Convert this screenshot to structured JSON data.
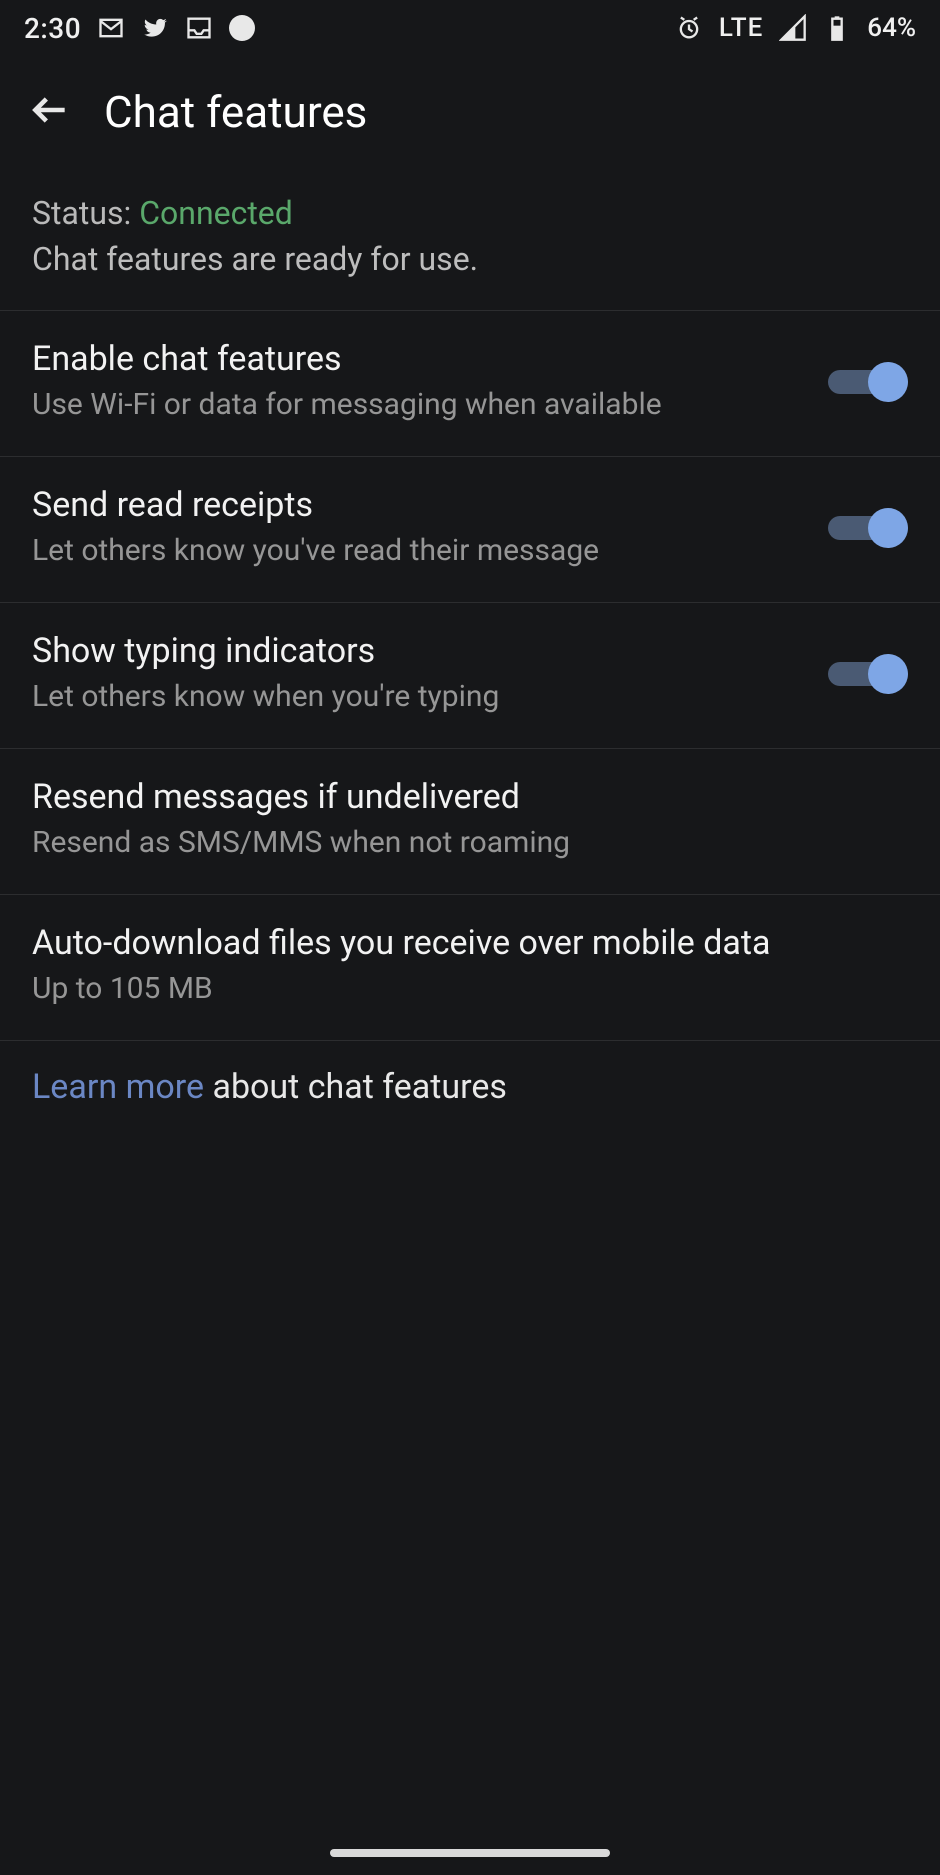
{
  "statusbar": {
    "time": "2:30",
    "network": "LTE",
    "battery": "64%"
  },
  "header": {
    "title": "Chat features"
  },
  "status": {
    "label": "Status: ",
    "value": "Connected",
    "subtitle": "Chat features are ready for use."
  },
  "settings": [
    {
      "title": "Enable chat features",
      "subtitle": "Use Wi-Fi or data for messaging when available",
      "toggle": true
    },
    {
      "title": "Send read receipts",
      "subtitle": "Let others know you've read their message",
      "toggle": true
    },
    {
      "title": "Show typing indicators",
      "subtitle": "Let others know when you're typing",
      "toggle": true
    },
    {
      "title": "Resend messages if undelivered",
      "subtitle": "Resend as SMS/MMS when not roaming",
      "toggle": null
    },
    {
      "title": "Auto-download files you receive over mobile data",
      "subtitle": "Up to 105 MB",
      "toggle": null
    }
  ],
  "learn": {
    "link": "Learn more",
    "rest": " about chat features"
  }
}
